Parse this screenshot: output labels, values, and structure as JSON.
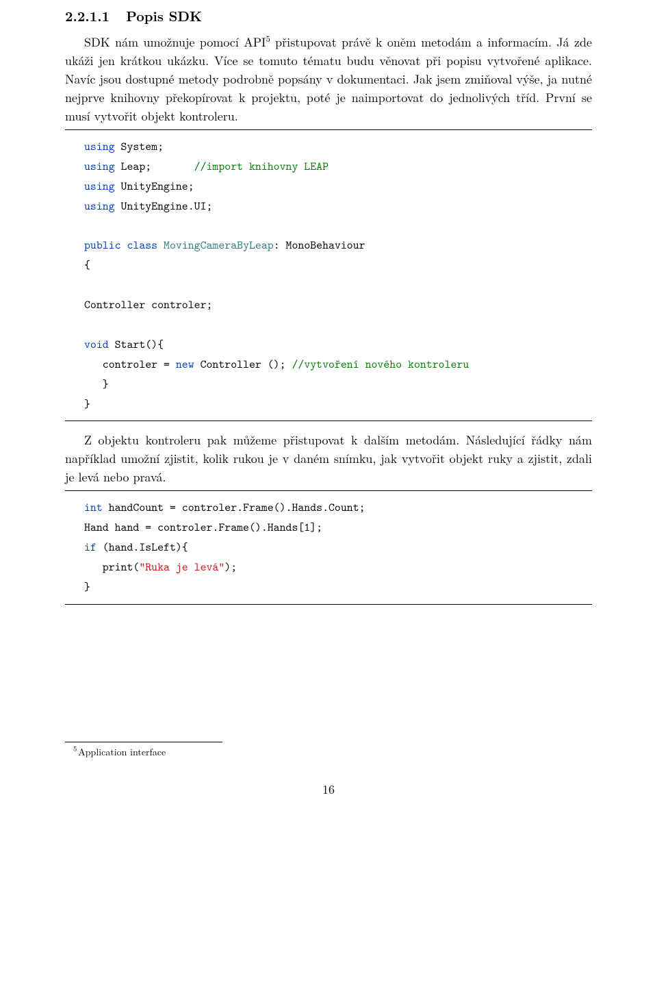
{
  "section": {
    "number": "2.2.1.1",
    "title": "Popis SDK"
  },
  "para1": {
    "pre": "SDK nám umožnuje pomocí API",
    "sup": "5",
    "post": " přistupovat právě k oněm metodám a informacím. Já zde ukáži jen krátkou ukázku. Více se tomuto tématu budu věnovat při popisu vytvořené aplikace. Navíc jsou dostupné metody podrobně popsány v dokumentaci. Jak jsem zmiňoval výše, ja nutné nejprve knihovny překopírovat k projektu, poté je naimportovat do jednolivých tříd. První se musí vytvořit objekt kontroleru."
  },
  "code1": {
    "l1_kw": "using",
    "l1_rest": " System;",
    "l2_kw": "using",
    "l2_rest": " Leap;       ",
    "l2_cm": "//import knihovny LEAP",
    "l3_kw": "using",
    "l3_rest": " UnityEngine;",
    "l4_kw": "using",
    "l4_rest": " UnityEngine.UI;",
    "l5_kw1": "public",
    "l5_kw2": " class",
    "l5_ty": " MovingCameraByLeap",
    "l5_rest": ": MonoBehaviour",
    "l6": "{",
    "l7": "Controller controler;",
    "l8_kw": "void",
    "l8_rest": " Start(){",
    "l9_pre": "   controler = ",
    "l9_kw": "new",
    "l9_rest": " Controller (); ",
    "l9_cm": "//vytvoření nového kontroleru",
    "l10": "   }",
    "l11": "}"
  },
  "para2": "Z objektu kontroleru pak můžeme přistupovat k dalším metodám. Následující řádky nám například umožní zjistit, kolik rukou je v daném snímku, jak vytvořit objekt ruky a zjistit, zdali je levá nebo pravá.",
  "code2": {
    "l1_kw": "int",
    "l1_rest": " handCount = controler.Frame().Hands.Count;",
    "l2": "Hand hand = controler.Frame().Hands[1];",
    "l3_kw": "if",
    "l3_rest": " (hand.IsLeft){",
    "l4_pre": "   print(",
    "l4_st": "\"Ruka je levá\"",
    "l4_post": ");",
    "l5": "}"
  },
  "footnote": {
    "marker": "5",
    "text": "Application interface"
  },
  "page_number": "16"
}
